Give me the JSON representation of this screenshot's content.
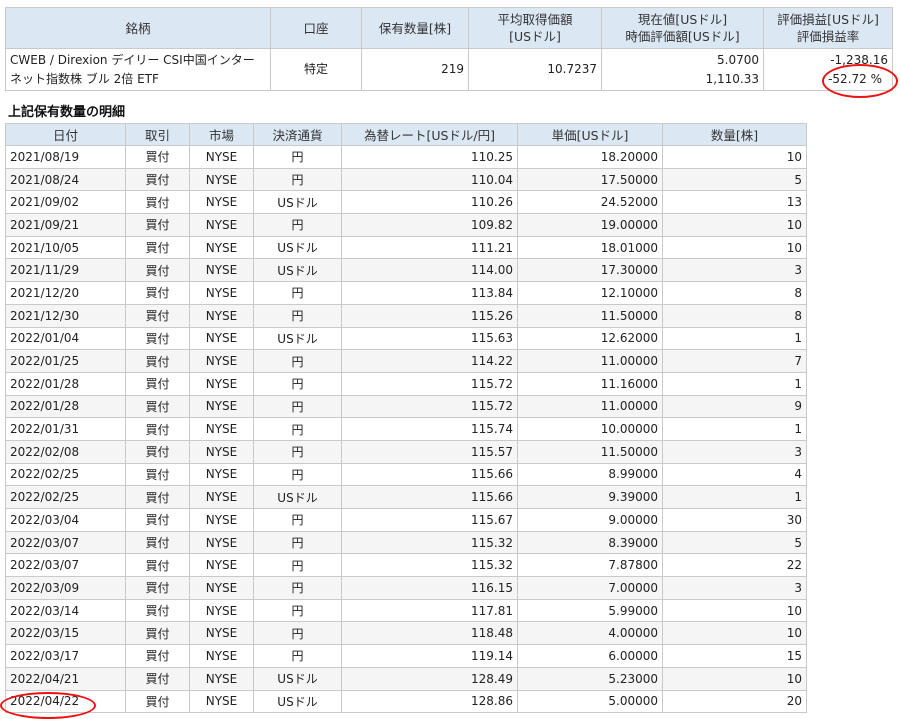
{
  "summary": {
    "headers": {
      "name": "銘柄",
      "account": "口座",
      "quantity": "保有数量[株]",
      "avg_cost_1": "平均取得価額",
      "avg_cost_2": "[USドル]",
      "current_1": "現在値[USドル]",
      "current_2": "時価評価額[USドル]",
      "pl_1": "評価損益[USドル]",
      "pl_2": "評価損益率"
    },
    "row": {
      "name_1": "CWEB / Direxion デイリー CSI中国インター",
      "name_2": "ネット指数株 ブル 2倍 ETF",
      "account": "特定",
      "quantity": "219",
      "avg_cost": "10.7237",
      "current_price": "5.0700",
      "market_value": "1,110.33",
      "pl_amount": "-1,238.16",
      "pl_rate": "-52.72 %"
    }
  },
  "detail": {
    "title": "上記保有数量の明細",
    "headers": {
      "date": "日付",
      "trade": "取引",
      "market": "市場",
      "currency": "決済通貨",
      "fx": "為替レート[USドル/円]",
      "price": "単価[USドル]",
      "qty": "数量[株]"
    },
    "rows": [
      {
        "date": "2021/08/19",
        "trade": "買付",
        "market": "NYSE",
        "currency": "円",
        "fx": "110.25",
        "price": "18.20000",
        "qty": "10"
      },
      {
        "date": "2021/08/24",
        "trade": "買付",
        "market": "NYSE",
        "currency": "円",
        "fx": "110.04",
        "price": "17.50000",
        "qty": "5"
      },
      {
        "date": "2021/09/02",
        "trade": "買付",
        "market": "NYSE",
        "currency": "USドル",
        "fx": "110.26",
        "price": "24.52000",
        "qty": "13"
      },
      {
        "date": "2021/09/21",
        "trade": "買付",
        "market": "NYSE",
        "currency": "円",
        "fx": "109.82",
        "price": "19.00000",
        "qty": "10"
      },
      {
        "date": "2021/10/05",
        "trade": "買付",
        "market": "NYSE",
        "currency": "USドル",
        "fx": "111.21",
        "price": "18.01000",
        "qty": "10"
      },
      {
        "date": "2021/11/29",
        "trade": "買付",
        "market": "NYSE",
        "currency": "USドル",
        "fx": "114.00",
        "price": "17.30000",
        "qty": "3"
      },
      {
        "date": "2021/12/20",
        "trade": "買付",
        "market": "NYSE",
        "currency": "円",
        "fx": "113.84",
        "price": "12.10000",
        "qty": "8"
      },
      {
        "date": "2021/12/30",
        "trade": "買付",
        "market": "NYSE",
        "currency": "円",
        "fx": "115.26",
        "price": "11.50000",
        "qty": "8"
      },
      {
        "date": "2022/01/04",
        "trade": "買付",
        "market": "NYSE",
        "currency": "USドル",
        "fx": "115.63",
        "price": "12.62000",
        "qty": "1"
      },
      {
        "date": "2022/01/25",
        "trade": "買付",
        "market": "NYSE",
        "currency": "円",
        "fx": "114.22",
        "price": "11.00000",
        "qty": "7"
      },
      {
        "date": "2022/01/28",
        "trade": "買付",
        "market": "NYSE",
        "currency": "円",
        "fx": "115.72",
        "price": "11.16000",
        "qty": "1"
      },
      {
        "date": "2022/01/28",
        "trade": "買付",
        "market": "NYSE",
        "currency": "円",
        "fx": "115.72",
        "price": "11.00000",
        "qty": "9"
      },
      {
        "date": "2022/01/31",
        "trade": "買付",
        "market": "NYSE",
        "currency": "円",
        "fx": "115.74",
        "price": "10.00000",
        "qty": "1"
      },
      {
        "date": "2022/02/08",
        "trade": "買付",
        "market": "NYSE",
        "currency": "円",
        "fx": "115.57",
        "price": "11.50000",
        "qty": "3"
      },
      {
        "date": "2022/02/25",
        "trade": "買付",
        "market": "NYSE",
        "currency": "円",
        "fx": "115.66",
        "price": "8.99000",
        "qty": "4"
      },
      {
        "date": "2022/02/25",
        "trade": "買付",
        "market": "NYSE",
        "currency": "USドル",
        "fx": "115.66",
        "price": "9.39000",
        "qty": "1"
      },
      {
        "date": "2022/03/04",
        "trade": "買付",
        "market": "NYSE",
        "currency": "円",
        "fx": "115.67",
        "price": "9.00000",
        "qty": "30"
      },
      {
        "date": "2022/03/07",
        "trade": "買付",
        "market": "NYSE",
        "currency": "円",
        "fx": "115.32",
        "price": "8.39000",
        "qty": "5"
      },
      {
        "date": "2022/03/07",
        "trade": "買付",
        "market": "NYSE",
        "currency": "円",
        "fx": "115.32",
        "price": "7.87800",
        "qty": "22"
      },
      {
        "date": "2022/03/09",
        "trade": "買付",
        "market": "NYSE",
        "currency": "円",
        "fx": "116.15",
        "price": "7.00000",
        "qty": "3"
      },
      {
        "date": "2022/03/14",
        "trade": "買付",
        "market": "NYSE",
        "currency": "円",
        "fx": "117.81",
        "price": "5.99000",
        "qty": "10"
      },
      {
        "date": "2022/03/15",
        "trade": "買付",
        "market": "NYSE",
        "currency": "円",
        "fx": "118.48",
        "price": "4.00000",
        "qty": "10"
      },
      {
        "date": "2022/03/17",
        "trade": "買付",
        "market": "NYSE",
        "currency": "円",
        "fx": "119.14",
        "price": "6.00000",
        "qty": "15"
      },
      {
        "date": "2022/04/21",
        "trade": "買付",
        "market": "NYSE",
        "currency": "USドル",
        "fx": "128.49",
        "price": "5.23000",
        "qty": "10"
      },
      {
        "date": "2022/04/22",
        "trade": "買付",
        "market": "NYSE",
        "currency": "USドル",
        "fx": "128.86",
        "price": "5.00000",
        "qty": "20"
      }
    ]
  },
  "annotation_color": "#ee1111"
}
